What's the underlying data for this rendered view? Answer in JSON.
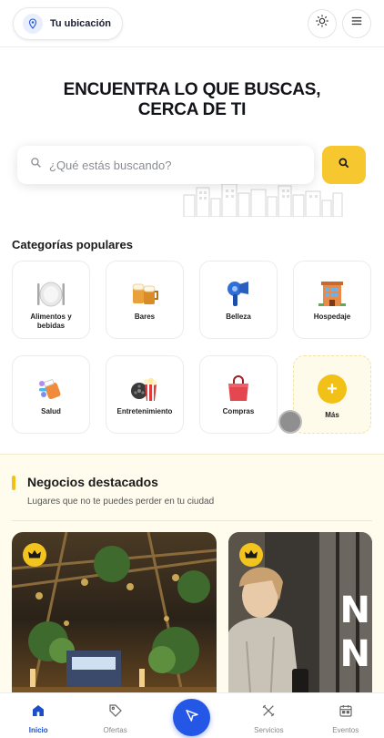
{
  "header": {
    "location_label": "Tu ubicación",
    "location_icon": "location-pin-icon",
    "theme_icon": "sun-icon",
    "menu_icon": "hamburger-menu-icon"
  },
  "hero": {
    "title_line1": "ENCUENTRA LO QUE BUSCAS,",
    "title_line2": "CERCA DE TI"
  },
  "search": {
    "placeholder": "¿Qué estás buscando?",
    "search_icon": "search-icon"
  },
  "categories": {
    "title": "Categorías populares",
    "items": [
      {
        "label": "Alimentos y bebidas",
        "icon": "plate-cutlery-icon"
      },
      {
        "label": "Bares",
        "icon": "beer-mugs-icon"
      },
      {
        "label": "Belleza",
        "icon": "hair-dryer-icon"
      },
      {
        "label": "Hospedaje",
        "icon": "hotel-building-icon"
      },
      {
        "label": "Salud",
        "icon": "medicine-icon"
      },
      {
        "label": "Entretenimiento",
        "icon": "popcorn-film-icon"
      },
      {
        "label": "Compras",
        "icon": "shopping-bag-icon"
      },
      {
        "label": "Más",
        "icon": "plus-icon"
      }
    ]
  },
  "featured": {
    "title": "Negocios destacados",
    "subtitle": "Lugares que no te puedes perder en tu ciudad",
    "badge_icon": "crown-icon",
    "card2_letters": [
      "N",
      "N"
    ]
  },
  "nav": {
    "items": [
      {
        "label": "Inicio",
        "icon": "home-icon",
        "active": true
      },
      {
        "label": "Ofertas",
        "icon": "tag-icon",
        "active": false
      },
      {
        "label": "",
        "icon": "navigation-arrow-icon",
        "active": false
      },
      {
        "label": "Servicios",
        "icon": "tools-icon",
        "active": false
      },
      {
        "label": "Eventos",
        "icon": "calendar-icon",
        "active": false
      }
    ]
  },
  "colors": {
    "accent_yellow": "#f7c72f",
    "primary_blue": "#2457e6",
    "featured_bg": "#fffcee"
  }
}
